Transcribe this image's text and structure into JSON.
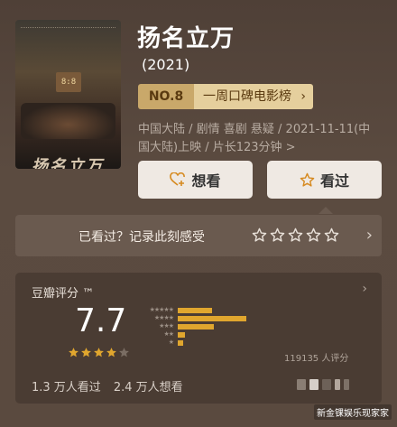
{
  "movie": {
    "title": "扬名立万",
    "year": "(2021)",
    "rank_no": "NO.8",
    "rank_list": "一周口碑电影榜",
    "meta_line": "中国大陆 / 剧情 喜剧 悬疑 / 2021-11-11(中国大陆)上映 / 片长123分钟 >",
    "poster_title": "扬名立万",
    "poster_clock": "8:8"
  },
  "actions": {
    "want_label": "想看",
    "seen_label": "看过",
    "want_icon": "heart-plus-icon",
    "seen_icon": "star-outline-icon"
  },
  "record": {
    "prompt": "已看过？记录此刻感受",
    "star_count": 5
  },
  "rating": {
    "header": "豆瓣评分 ™",
    "score": "7.7",
    "stars_filled": 4,
    "stars_total": 5,
    "count_text": "119135 人评分",
    "distribution": [
      {
        "stars": 5,
        "fraction": 0.2
      },
      {
        "stars": 4,
        "fraction": 0.4
      },
      {
        "stars": 3,
        "fraction": 0.21
      },
      {
        "stars": 2,
        "fraction": 0.04
      },
      {
        "stars": 1,
        "fraction": 0.03
      }
    ],
    "watched": "1.3 万人看过",
    "want": "2.4 万人想看"
  },
  "watermark": "新金锞娱乐现家家",
  "colors": {
    "accent": "#e0a62e",
    "rank_dark": "#c9a86a",
    "rank_light": "#e5cf9d",
    "background": "#5a4a3f"
  }
}
